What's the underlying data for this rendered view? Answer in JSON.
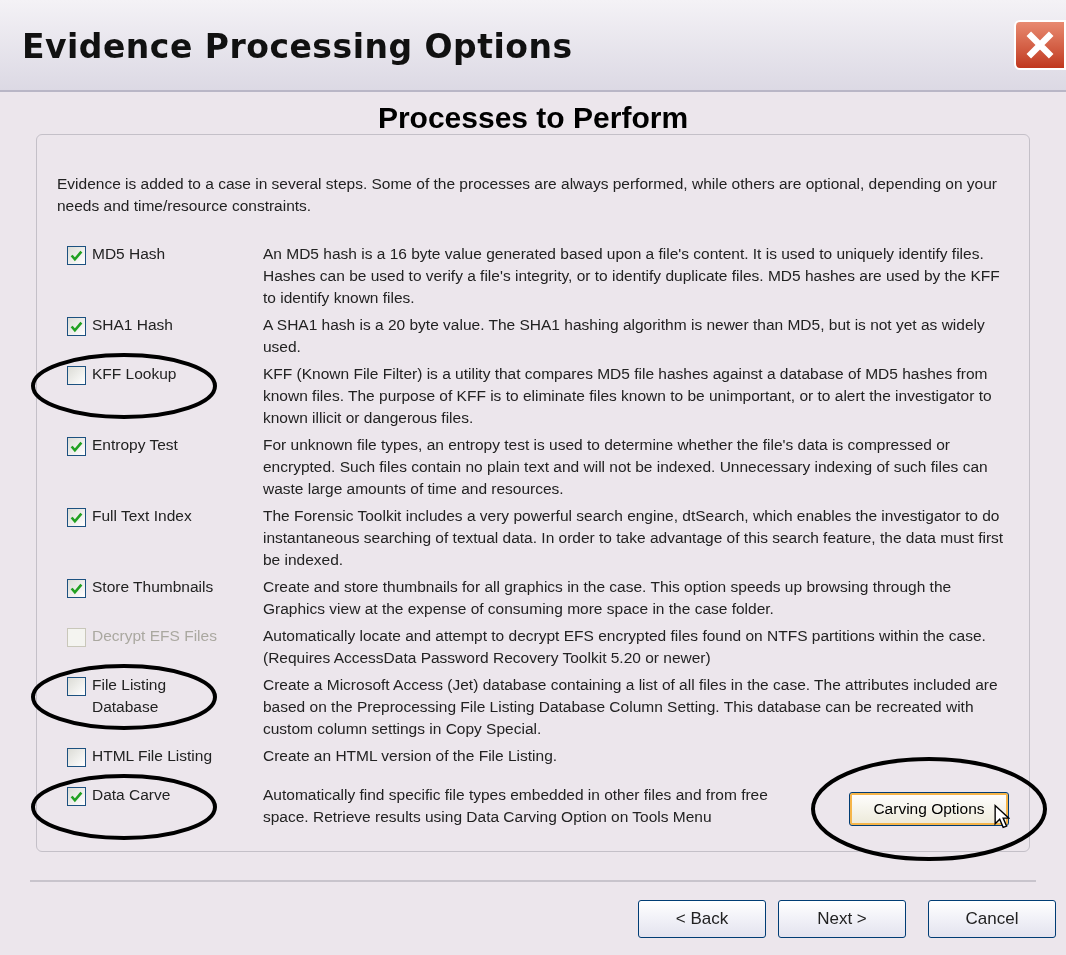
{
  "window": {
    "title": "Evidence Processing Options"
  },
  "heading": "Processes to Perform",
  "intro": "Evidence is added to a case in several steps. Some of the processes are always performed, while others are optional, depending on your needs and time/resource constraints.",
  "options": [
    {
      "label": "MD5 Hash",
      "checked": true,
      "disabled": false,
      "circled": false,
      "description": "An MD5 hash is a 16 byte value generated based upon a file's content. It is used to uniquely identify files. Hashes can be used to verify a file's integrity, or to identify duplicate files. MD5 hashes are used by the KFF to identify known files."
    },
    {
      "label": "SHA1 Hash",
      "checked": true,
      "disabled": false,
      "circled": false,
      "description": "A SHA1 hash is a 20 byte value. The SHA1 hashing algorithm is newer than MD5, but is not yet as widely used."
    },
    {
      "label": "KFF Lookup",
      "checked": false,
      "disabled": false,
      "circled": true,
      "description": "KFF (Known File Filter) is a utility that compares MD5 file hashes against a database of MD5 hashes from known files. The purpose of KFF is to eliminate files known to be unimportant, or to alert the investigator to known illicit or dangerous files."
    },
    {
      "label": "Entropy Test",
      "checked": true,
      "disabled": false,
      "circled": false,
      "description": "For unknown file types, an entropy test is used to determine whether the file's data is compressed or encrypted. Such files contain no plain text and will not be indexed. Unnecessary indexing of such files can waste large amounts of time and resources."
    },
    {
      "label": "Full Text Index",
      "checked": true,
      "disabled": false,
      "circled": false,
      "description": "The Forensic Toolkit includes a very powerful search engine, dtSearch, which enables the investigator to do instantaneous searching of textual data. In order to take advantage of this search feature, the data must first be indexed."
    },
    {
      "label": "Store Thumbnails",
      "checked": true,
      "disabled": false,
      "circled": false,
      "description": "Create and store thumbnails for all graphics in the case.  This option speeds up browsing through the Graphics view at the expense of consuming more space in the case folder."
    },
    {
      "label": "Decrypt EFS Files",
      "checked": false,
      "disabled": true,
      "circled": false,
      "description": "Automatically locate and attempt to decrypt EFS encrypted files found on NTFS partitions within the case.  (Requires AccessData Password Recovery Toolkit 5.20 or newer)"
    },
    {
      "label": "File Listing Database",
      "checked": false,
      "disabled": false,
      "circled": true,
      "description": "Create a Microsoft Access (Jet) database containing a list of all files in the case.  The attributes included are based on the Preprocessing File Listing Database Column Setting.  This database can be recreated with custom column settings in Copy Special."
    },
    {
      "label": "HTML File Listing",
      "checked": false,
      "disabled": false,
      "circled": false,
      "description": "Create an HTML version of the File Listing."
    },
    {
      "label": "Data Carve",
      "checked": true,
      "disabled": false,
      "circled": true,
      "description": "Automatically find specific file types embedded in other files and from free space.  Retrieve results using Data Carving Option on Tools Menu",
      "button": {
        "label": "Carving Options",
        "circled": true
      }
    }
  ],
  "buttons": [
    {
      "label": "< Back"
    },
    {
      "label": "Next >"
    },
    {
      "label": "Cancel"
    }
  ]
}
